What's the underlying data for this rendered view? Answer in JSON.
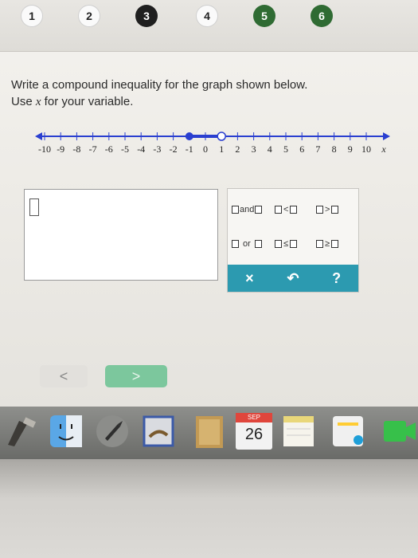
{
  "steps": [
    {
      "label": "1",
      "state": "light"
    },
    {
      "label": "2",
      "state": "light"
    },
    {
      "label": "3",
      "state": "active"
    },
    {
      "label": "4",
      "state": "light"
    },
    {
      "label": "5",
      "state": "green"
    },
    {
      "label": "6",
      "state": "green"
    }
  ],
  "problem": {
    "line1": "Write a compound inequality for the graph shown below.",
    "line2_prefix": "Use ",
    "line2_var": "x",
    "line2_suffix": " for your variable."
  },
  "number_line": {
    "ticks": [
      "-10",
      "-9",
      "-8",
      "-7",
      "-6",
      "-5",
      "-4",
      "-3",
      "-2",
      "-1",
      "0",
      "1",
      "2",
      "3",
      "4",
      "5",
      "6",
      "7",
      "8",
      "9",
      "10"
    ],
    "variable": "x",
    "closed_point": -1,
    "open_point": 1
  },
  "keypad": {
    "and_label": "and",
    "or_label": "or",
    "lt": "<",
    "gt": ">",
    "le": "≤",
    "ge": "≥",
    "clear": "×",
    "undo": "↶",
    "help": "?"
  },
  "nav": {
    "back": "<",
    "next": ">"
  },
  "dock": {
    "calendar_month": "SEP",
    "calendar_day": "26"
  },
  "colors": {
    "accent_teal": "#2c9ab0",
    "step_green": "#2f6b33",
    "next_green": "#7cc79d",
    "number_line_blue": "#2a3fd0"
  }
}
